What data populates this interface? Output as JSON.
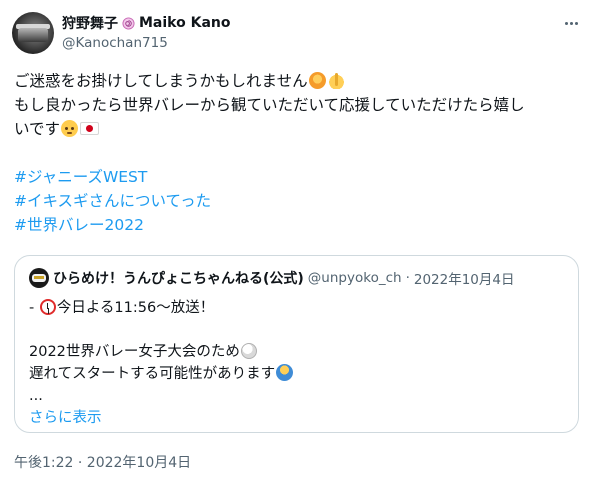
{
  "author": {
    "display_name": "狩野舞子",
    "display_name_en": "Maiko Kano",
    "handle": "@Kanochan715",
    "avatar_icon": "avatar",
    "badge_icon": "swirl-icon"
  },
  "menu": {
    "more_icon": "more-icon"
  },
  "tweet": {
    "line1": "ご迷惑をお掛けしてしまうかもしれません",
    "line2": "もし良かったら世界バレーから観ていただいて応援していただけたら嬉し",
    "line3": "いです",
    "hashtags": [
      "#ジャニーズWEST",
      "#イキスギさんについてった",
      "#世界バレー2022"
    ]
  },
  "quoted": {
    "name": "ひらめけ！うんぴょこちゃんねる(公式)",
    "handle": "@unpyoko_ch",
    "separator": "·",
    "date": "2022年10月4日",
    "line1_prefix": "- ",
    "line1_text": "今日よる11:56〜放送！",
    "line2": "2022世界バレー女子大会のため",
    "line3": "遅れてスタートする可能性があります",
    "line4": "...",
    "show_more": "さらに表示"
  },
  "timestamp": "午後1:22 · 2022年10月4日",
  "colors": {
    "link": "#1d9bf0",
    "secondary": "#536471",
    "border": "#cfd9de",
    "text": "#0f1419"
  }
}
